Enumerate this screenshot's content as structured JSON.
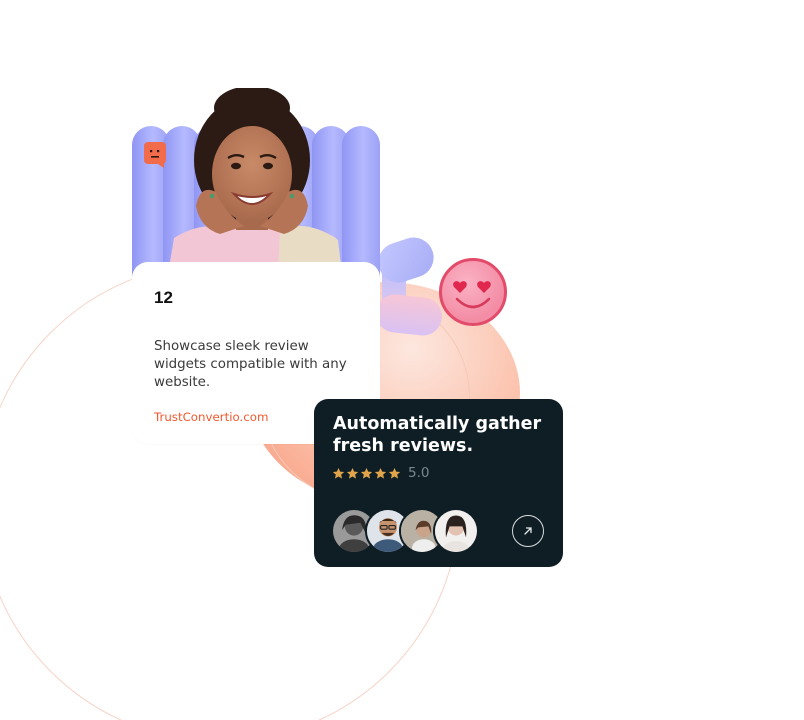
{
  "stats_card": {
    "count": "12",
    "description": "Showcase sleek review widgets compatible with any website.",
    "brand": "TrustConvertio.com"
  },
  "review_card": {
    "headline": "Automatically gather fresh reviews.",
    "stars": 5,
    "rating": "5.0",
    "star_color": "#e2a44a",
    "reviewer_count": 4
  },
  "colors": {
    "accent_orange": "#f2592e",
    "dark_card": "#0f1e24",
    "pill_purple": "#a7acf5",
    "smiley_pink": "#f38ca5"
  },
  "icons": {
    "chat": "chat-bubble-icon",
    "smiley": "heart-eyes-smiley-icon",
    "arrow": "arrow-up-right-icon",
    "star": "star-icon"
  }
}
